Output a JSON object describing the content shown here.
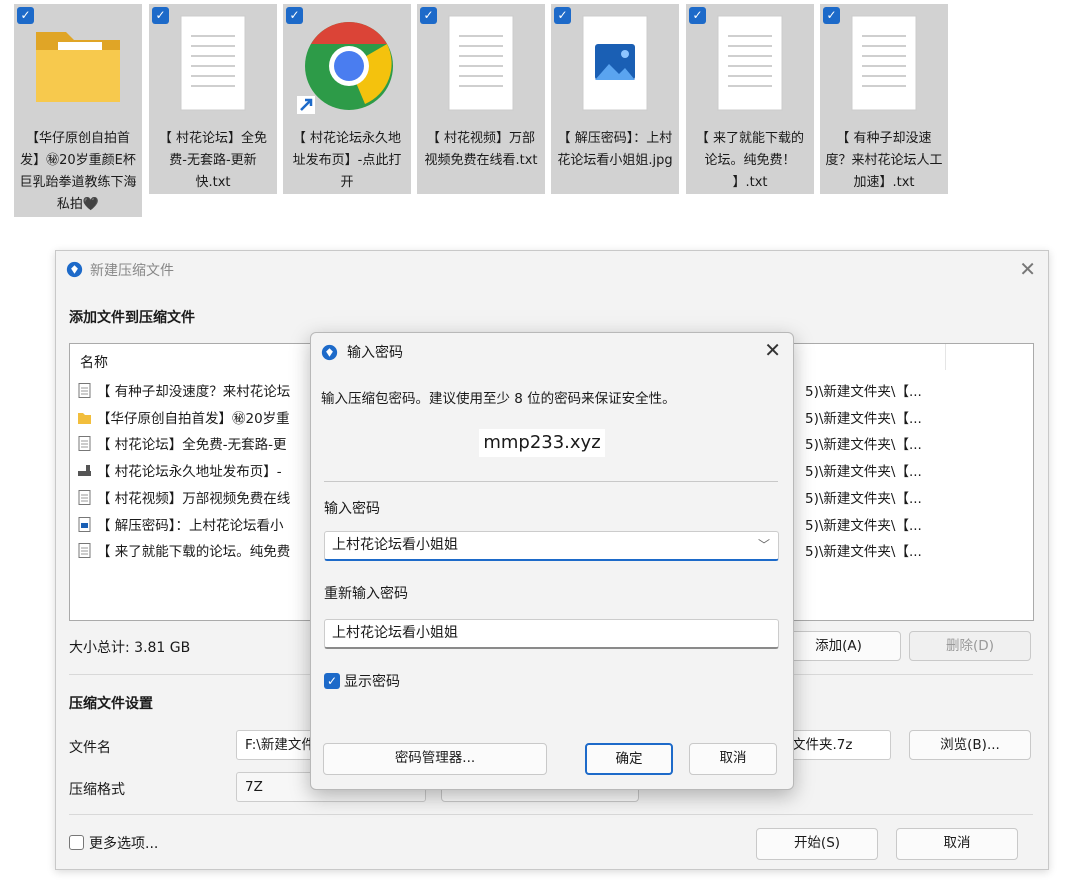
{
  "tiles": [
    {
      "label": "【华仔原创自拍首发】㊙20岁重颜E杯巨乳跆拳道教练下海私拍🖤",
      "icon": "folder-icon"
    },
    {
      "label": "【 村花论坛】全免费-无套路-更新快.txt",
      "icon": "text-file-icon"
    },
    {
      "label": "【 村花论坛永久地址发布页】-点此打开",
      "icon": "chrome-shortcut-icon"
    },
    {
      "label": "【 村花视频】万部视频免费在线看.txt",
      "icon": "text-file-icon"
    },
    {
      "label": "【 解压密码】：上村花论坛看小姐姐.jpg",
      "icon": "image-file-icon"
    },
    {
      "label": "【 来了就能下载的论坛。纯免费！ 】.txt",
      "icon": "text-file-icon"
    },
    {
      "label": "【 有种子却没速度？来村花论坛人工加速】.txt",
      "icon": "text-file-icon"
    }
  ],
  "main": {
    "title": "新建压缩文件",
    "add_section": "添加文件到压缩文件",
    "list_header": "名称",
    "rows": [
      {
        "name": "【 有种子却没速度？来村花论坛",
        "path": "5)\\新建文件夹\\【...",
        "icon": "text-file-icon"
      },
      {
        "name": "【华仔原创自拍首发】㊙20岁重",
        "path": "5)\\新建文件夹\\【...",
        "icon": "folder-icon"
      },
      {
        "name": "【 村花论坛】全免费-无套路-更",
        "path": "5)\\新建文件夹\\【...",
        "icon": "text-file-icon"
      },
      {
        "name": "【 村花论坛永久地址发布页】-",
        "path": "5)\\新建文件夹\\【...",
        "icon": "shortcut-icon"
      },
      {
        "name": "【 村花视频】万部视频免费在线",
        "path": "5)\\新建文件夹\\【...",
        "icon": "text-file-icon"
      },
      {
        "name": "【 解压密码】：上村花论坛看小",
        "path": "5)\\新建文件夹\\【...",
        "icon": "image-file-icon"
      },
      {
        "name": "【 来了就能下载的论坛。纯免费",
        "path": "5)\\新建文件夹\\【...",
        "icon": "text-file-icon"
      }
    ],
    "total_size": "大小总计: 3.81 GB",
    "add_button": "添加(A)",
    "delete_button": "删除(D)",
    "settings_section": "压缩文件设置",
    "filename_label": "文件名",
    "filename_value": "F:\\新建文件",
    "filename_suffix": "文件夹.7z",
    "browse_button": "浏览(B)...",
    "format_label": "压缩格式",
    "format_value": "7Z",
    "more_options": "更多选项...",
    "start_button": "开始(S)",
    "cancel_button": "取消"
  },
  "password": {
    "title": "输入密码",
    "hint": "输入压缩包密码。建议使用至少 8 位的密码来保证安全性。",
    "watermark": "mmp233.xyz",
    "pwd_label": "输入密码",
    "pwd_value": "上村花论坛看小姐姐",
    "repeat_label": "重新输入密码",
    "repeat_value": "上村花论坛看小姐姐",
    "show_label": "显示密码",
    "manager_button": "密码管理器...",
    "ok_button": "确定",
    "cancel_button": "取消"
  },
  "colors": {
    "accent": "#1d6ac9",
    "tile_bg": "#d2d2d2",
    "dialog_bg": "#f3f3f3"
  }
}
